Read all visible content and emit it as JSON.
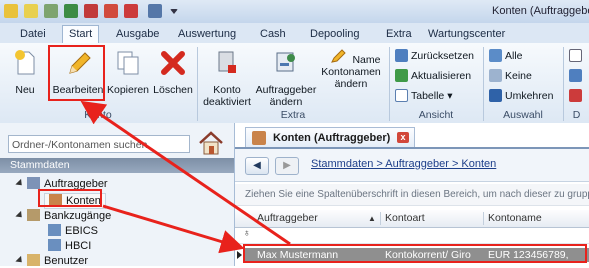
{
  "window": {
    "title": "Konten (Auftraggeber"
  },
  "quick_access": [
    "save-icon",
    "undo-icon",
    "print-icon",
    "export-icon",
    "mail-icon",
    "customize-icon"
  ],
  "ribbon_tabs": [
    {
      "label": "Datei",
      "active": false
    },
    {
      "label": "Start",
      "active": true
    },
    {
      "label": "Ausgabe",
      "active": false
    },
    {
      "label": "Auswertung",
      "active": false
    },
    {
      "label": "Cash",
      "active": false
    },
    {
      "label": "Depooling",
      "active": false
    },
    {
      "label": "Extra",
      "active": false
    },
    {
      "label": "Wartungscenter",
      "active": false
    }
  ],
  "ribbon": {
    "konto_group": {
      "label": "Konto",
      "neu": "Neu",
      "bearbeiten": "Bearbeiten",
      "kopieren": "Kopieren",
      "loeschen": "Löschen"
    },
    "extra_group": {
      "label": "Extra",
      "deaktiviert": [
        "Konto",
        "deaktiviert"
      ],
      "auftraggeber_aendern": [
        "Auftraggeber",
        "ändern"
      ],
      "kontonamen_aendern": [
        "Name",
        "Kontonamen",
        "ändern"
      ]
    },
    "ansicht_group": {
      "label": "Ansicht",
      "zuruecksetzen": "Zurücksetzen",
      "aktualisieren": "Aktualisieren",
      "tabelle": "Tabelle"
    },
    "auswahl_group": {
      "label": "Auswahl",
      "alle": "Alle",
      "keine": "Keine",
      "umkehren": "Umkehren"
    },
    "cut_group": {
      "label": "D"
    }
  },
  "sidebar": {
    "search_placeholder": "Ordner-/Kontonamen suchen",
    "section_header": "Stammdaten",
    "tree": [
      {
        "label": "Auftraggeber",
        "level": 0,
        "icon": "people-icon"
      },
      {
        "label": "Konten",
        "level": 1,
        "icon": "accounts-icon",
        "selected": true
      },
      {
        "label": "Bankzugänge",
        "level": 0,
        "icon": "bank-icon"
      },
      {
        "label": "EBICS",
        "level": 1,
        "icon": "ebics-icon"
      },
      {
        "label": "HBCI",
        "level": 1,
        "icon": "hbci-icon"
      },
      {
        "label": "Benutzer",
        "level": 0,
        "icon": "user-icon"
      }
    ]
  },
  "document": {
    "tab_title": "Konten (Auftraggeber)",
    "close_glyph": "x",
    "breadcrumb": "Stammdaten > Auftraggeber > Konten",
    "nav_back": "◀",
    "nav_forward": "▶",
    "group_hint": "Ziehen Sie eine Spaltenüberschrift in diesen Bereich, um nach dieser zu gruppiere",
    "columns": [
      "Auftraggeber",
      "Kontoart",
      "Kontoname"
    ],
    "sort_indicator": "▲",
    "rows": [
      {
        "auftraggeber": "Max Mustermann",
        "kontoart": "Kontokorrent/ Giro",
        "kontoname": "EUR 123456789,"
      }
    ]
  },
  "colors": {
    "annotation_red": "#e8221c",
    "selected_row": "#8f8f8f",
    "ribbon_bg": "#dde8f4"
  }
}
